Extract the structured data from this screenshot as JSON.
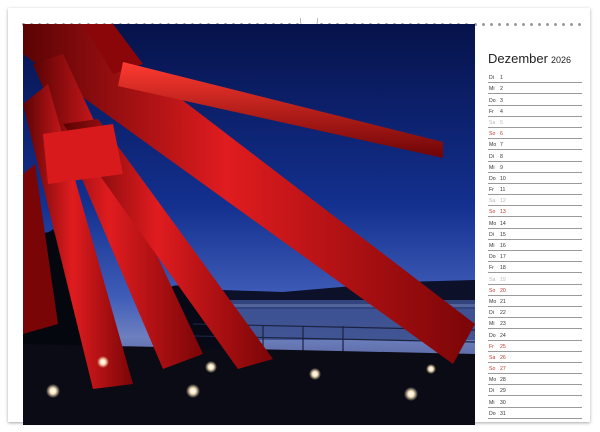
{
  "calendar": {
    "month": "Dezember",
    "year": "2026",
    "days": [
      {
        "wd": "Di",
        "day": "1",
        "type": "normal"
      },
      {
        "wd": "Mi",
        "day": "2",
        "type": "normal"
      },
      {
        "wd": "Do",
        "day": "3",
        "type": "normal"
      },
      {
        "wd": "Fr",
        "day": "4",
        "type": "normal"
      },
      {
        "wd": "Sa",
        "day": "5",
        "type": "saturday"
      },
      {
        "wd": "So",
        "day": "6",
        "type": "sunday"
      },
      {
        "wd": "Mo",
        "day": "7",
        "type": "normal"
      },
      {
        "wd": "Di",
        "day": "8",
        "type": "normal"
      },
      {
        "wd": "Mi",
        "day": "9",
        "type": "normal"
      },
      {
        "wd": "Do",
        "day": "10",
        "type": "normal"
      },
      {
        "wd": "Fr",
        "day": "11",
        "type": "normal"
      },
      {
        "wd": "Sa",
        "day": "12",
        "type": "saturday"
      },
      {
        "wd": "So",
        "day": "13",
        "type": "sunday"
      },
      {
        "wd": "Mo",
        "day": "14",
        "type": "normal"
      },
      {
        "wd": "Di",
        "day": "15",
        "type": "normal"
      },
      {
        "wd": "Mi",
        "day": "16",
        "type": "normal"
      },
      {
        "wd": "Do",
        "day": "17",
        "type": "normal"
      },
      {
        "wd": "Fr",
        "day": "18",
        "type": "normal"
      },
      {
        "wd": "Sa",
        "day": "19",
        "type": "saturday"
      },
      {
        "wd": "So",
        "day": "20",
        "type": "sunday"
      },
      {
        "wd": "Mo",
        "day": "21",
        "type": "normal"
      },
      {
        "wd": "Di",
        "day": "22",
        "type": "normal"
      },
      {
        "wd": "Mi",
        "day": "23",
        "type": "normal"
      },
      {
        "wd": "Do",
        "day": "24",
        "type": "normal"
      },
      {
        "wd": "Fr",
        "day": "25",
        "type": "sunday"
      },
      {
        "wd": "Sa",
        "day": "26",
        "type": "sunday"
      },
      {
        "wd": "So",
        "day": "27",
        "type": "sunday"
      },
      {
        "wd": "Mo",
        "day": "28",
        "type": "normal"
      },
      {
        "wd": "Di",
        "day": "29",
        "type": "normal"
      },
      {
        "wd": "Mi",
        "day": "30",
        "type": "normal"
      },
      {
        "wd": "Do",
        "day": "31",
        "type": "normal"
      }
    ]
  },
  "colors": {
    "sky_top": "#0b1a5c",
    "sky_horizon": "#5a6fb8",
    "steel_red": "#c4141a",
    "sunday_red": "#c0392b",
    "saturday_gray": "#b8b8b8"
  }
}
